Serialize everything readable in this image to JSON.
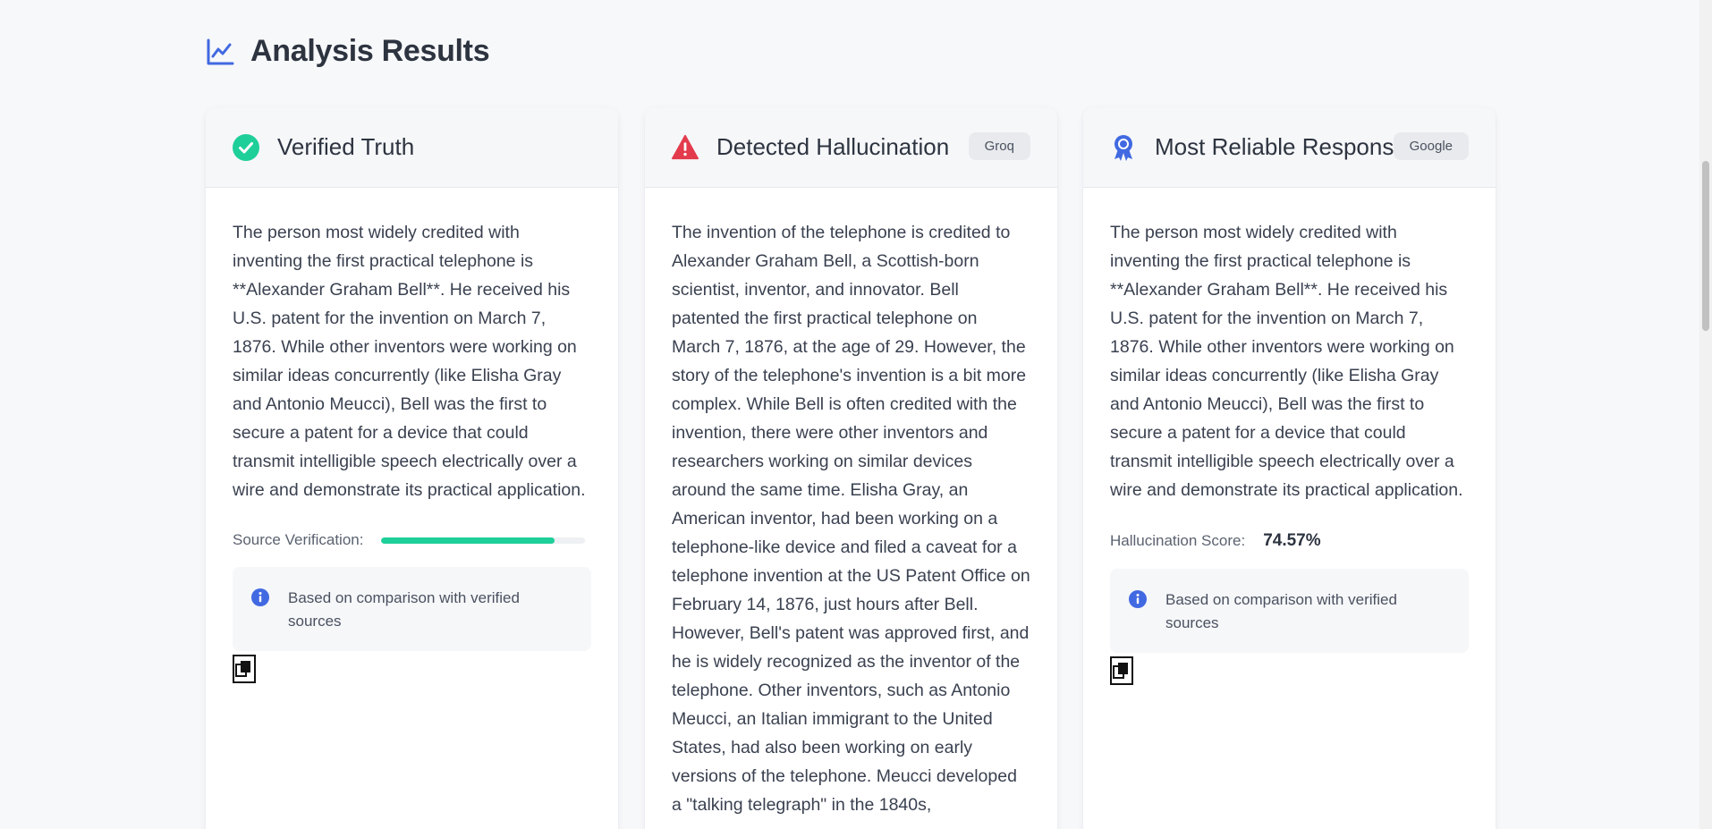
{
  "header": {
    "title": "Analysis Results",
    "icon": "line-chart-icon"
  },
  "colors": {
    "accent": "#4169e1",
    "success": "#1fcf9a",
    "danger": "#e33b4d",
    "text": "#2d3440"
  },
  "cards": [
    {
      "title": "Verified Truth",
      "icon": "check-circle-icon",
      "text": "The person most widely credited with inventing the first practical telephone is **Alexander Graham Bell**. He received his U.S. patent for the invention on March 7, 1876. While other inventors were working on similar ideas concurrently (like Elisha Gray and Antonio Meucci), Bell was the first to secure a patent for a device that could transmit intelligible speech electrically over a wire and demonstrate its practical application.",
      "verification_label": "Source Verification:",
      "verification_level": 0.85,
      "info": "Based on comparison with verified sources"
    },
    {
      "title": "Detected Hallucination",
      "icon": "warning-triangle-icon",
      "badge": "Groq",
      "text": "The invention of the telephone is credited to Alexander Graham Bell, a Scottish-born scientist, inventor, and innovator. Bell patented the first practical telephone on March 7, 1876, at the age of 29. However, the story of the telephone's invention is a bit more complex. While Bell is often credited with the invention, there were other inventors and researchers working on similar devices around the same time. Elisha Gray, an American inventor, had been working on a telephone-like device and filed a caveat for a telephone invention at the US Patent Office on February 14, 1876, just hours after Bell. However, Bell's patent was approved first, and he is widely recognized as the inventor of the telephone. Other inventors, such as Antonio Meucci, an Italian immigrant to the United States, had also been working on early versions of the telephone. Meucci developed a \"talking telegraph\" in the 1840s,"
    },
    {
      "title": "Most Reliable Response",
      "icon": "award-badge-icon",
      "badge": "Google",
      "text": "The person most widely credited with inventing the first practical telephone is **Alexander Graham Bell**. He received his U.S. patent for the invention on March 7, 1876. While other inventors were working on similar ideas concurrently (like Elisha Gray and Antonio Meucci), Bell was the first to secure a patent for a device that could transmit intelligible speech electrically over a wire and demonstrate its practical application.",
      "score_label": "Hallucination Score:",
      "score_value": "74.57%",
      "info": "Based on comparison with verified sources"
    }
  ]
}
